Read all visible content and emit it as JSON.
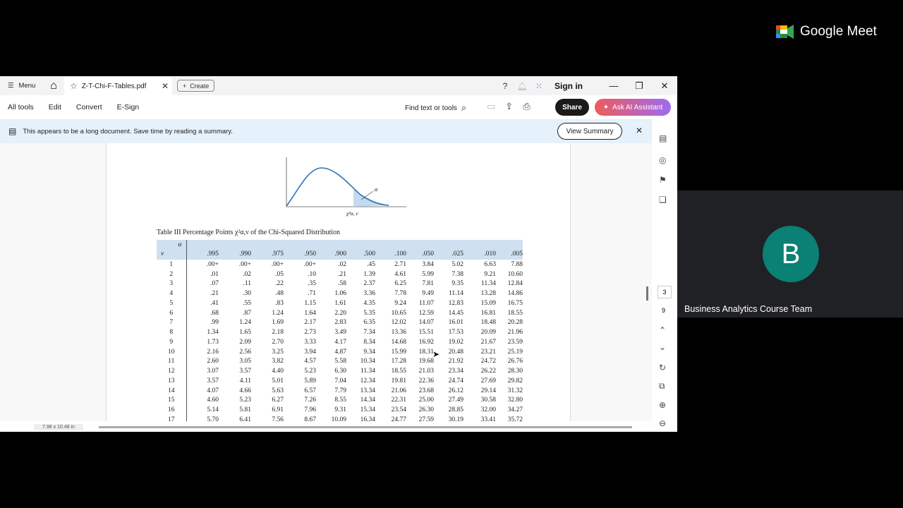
{
  "meet": {
    "brand": "Google Meet",
    "participant_initial": "B",
    "participant_name": "Business Analytics Course Team"
  },
  "acrobat": {
    "menu_label": "Menu",
    "tab_title": "Z-T-Chi-F-Tables.pdf",
    "create_label": "Create",
    "sign_in": "Sign in",
    "toolbar": {
      "items": [
        "All tools",
        "Edit",
        "Convert",
        "E-Sign"
      ],
      "find_placeholder": "Find text or tools",
      "share": "Share",
      "ai": "Ask AI Assistant"
    },
    "banner": {
      "text": "This appears to be a long document. Save time by reading a summary.",
      "button": "View Summary"
    },
    "page_current": "3",
    "page_total": "9",
    "page_size": "7.98 x 10.48 in"
  },
  "doc": {
    "chart_label_alpha": "α",
    "chart_label_x": "χ²α, ν",
    "table_caption": "Table III   Percentage Points χ²α,ν of the Chi-Squared Distribution",
    "alpha_symbol": "α",
    "nu_symbol": "ν",
    "alphas": [
      ".995",
      ".990",
      ".975",
      ".950",
      ".900",
      ".500",
      ".100",
      ".050",
      ".025",
      ".010",
      ".005"
    ],
    "rows": [
      [
        "1",
        ".00+",
        ".00+",
        ".00+",
        ".00+",
        ".02",
        ".45",
        "2.71",
        "3.84",
        "5.02",
        "6.63",
        "7.88"
      ],
      [
        "2",
        ".01",
        ".02",
        ".05",
        ".10",
        ".21",
        "1.39",
        "4.61",
        "5.99",
        "7.38",
        "9.21",
        "10.60"
      ],
      [
        "3",
        ".07",
        ".11",
        ".22",
        ".35",
        ".58",
        "2.37",
        "6.25",
        "7.81",
        "9.35",
        "11.34",
        "12.84"
      ],
      [
        "4",
        ".21",
        ".30",
        ".48",
        ".71",
        "1.06",
        "3.36",
        "7.78",
        "9.49",
        "11.14",
        "13.28",
        "14.86"
      ],
      [
        "5",
        ".41",
        ".55",
        ".83",
        "1.15",
        "1.61",
        "4.35",
        "9.24",
        "11.07",
        "12.83",
        "15.09",
        "16.75"
      ],
      [
        "6",
        ".68",
        ".87",
        "1.24",
        "1.64",
        "2.20",
        "5.35",
        "10.65",
        "12.59",
        "14.45",
        "16.81",
        "18.55"
      ],
      [
        "7",
        ".99",
        "1.24",
        "1.69",
        "2.17",
        "2.83",
        "6.35",
        "12.02",
        "14.07",
        "16.01",
        "18.48",
        "20.28"
      ],
      [
        "8",
        "1.34",
        "1.65",
        "2.18",
        "2.73",
        "3.49",
        "7.34",
        "13.36",
        "15.51",
        "17.53",
        "20.09",
        "21.96"
      ],
      [
        "9",
        "1.73",
        "2.09",
        "2.70",
        "3.33",
        "4.17",
        "8.34",
        "14.68",
        "16.92",
        "19.02",
        "21.67",
        "23.59"
      ],
      [
        "10",
        "2.16",
        "2.56",
        "3.25",
        "3.94",
        "4.87",
        "9.34",
        "15.99",
        "18.31",
        "20.48",
        "23.21",
        "25.19"
      ],
      [
        "11",
        "2.60",
        "3.05",
        "3.82",
        "4.57",
        "5.58",
        "10.34",
        "17.28",
        "19.68",
        "21.92",
        "24.72",
        "26.76"
      ],
      [
        "12",
        "3.07",
        "3.57",
        "4.40",
        "5.23",
        "6.30",
        "11.34",
        "18.55",
        "21.03",
        "23.34",
        "26.22",
        "28.30"
      ],
      [
        "13",
        "3.57",
        "4.11",
        "5.01",
        "5.89",
        "7.04",
        "12.34",
        "19.81",
        "22.36",
        "24.74",
        "27.69",
        "29.82"
      ],
      [
        "14",
        "4.07",
        "4.66",
        "5.63",
        "6.57",
        "7.79",
        "13.34",
        "21.06",
        "23.68",
        "26.12",
        "29.14",
        "31.32"
      ],
      [
        "15",
        "4.60",
        "5.23",
        "6.27",
        "7.26",
        "8.55",
        "14.34",
        "22.31",
        "25.00",
        "27.49",
        "30.58",
        "32.80"
      ],
      [
        "16",
        "5.14",
        "5.81",
        "6.91",
        "7.96",
        "9.31",
        "15.34",
        "23.54",
        "26.30",
        "28.85",
        "32.00",
        "34.27"
      ],
      [
        "17",
        "5.70",
        "6.41",
        "7.56",
        "8.67",
        "10.09",
        "16.34",
        "24.77",
        "27.59",
        "30.19",
        "33.41",
        "35.72"
      ]
    ]
  }
}
